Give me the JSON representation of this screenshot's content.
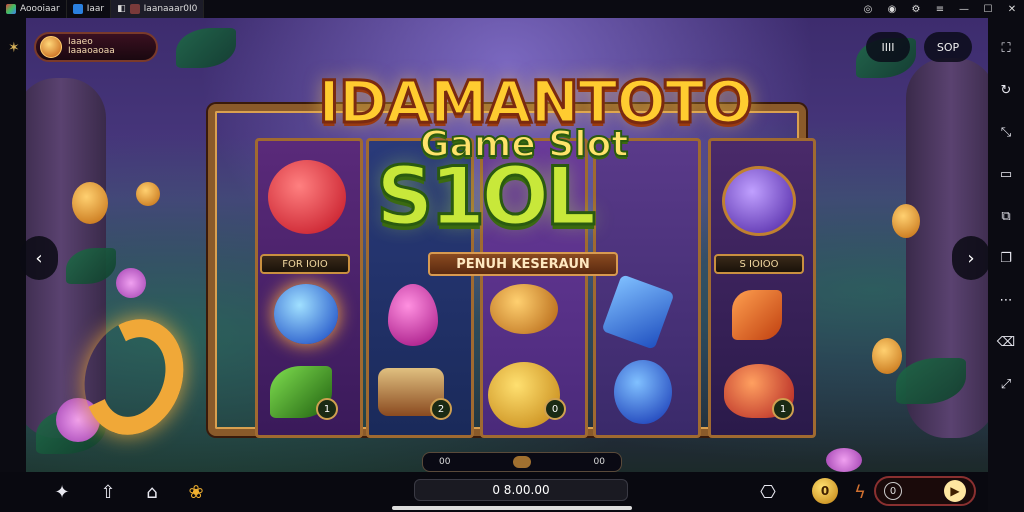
{
  "window": {
    "tabs": [
      {
        "label": "Aoooiaar",
        "icon": "app-store-icon"
      },
      {
        "label": "Iaar",
        "icon": "browser-icon"
      },
      {
        "label": "Iaanaaar0I0",
        "icon": "game-tab-icon"
      }
    ],
    "controls": [
      "circle-icon",
      "target-icon",
      "settings-icon",
      "menu-icon",
      "minimize-icon",
      "maximize-icon",
      "close-icon"
    ]
  },
  "game": {
    "badge": {
      "line1": "Iaaeo",
      "line2": "Iaaaoaoaa"
    },
    "top_right_pills": [
      "IIII",
      "SOP"
    ],
    "title": "IDAMANTOTO",
    "subtitle_small": "Game Slot",
    "subtitle_big": "S1OL",
    "banner": "PENUH KESERAUN",
    "reel_labels": [
      "FOR IOIO",
      "S IOIOO"
    ],
    "reel_counts": [
      "1",
      "2",
      "0",
      "1"
    ],
    "counter": {
      "left": "00",
      "right": "00"
    }
  },
  "bottom": {
    "balance": "0 8.00.00",
    "coin_label": "0",
    "spin_left": "0",
    "spin_right": "▶"
  },
  "colors": {
    "accent": "#ffcc30",
    "frame": "#8a5a2a",
    "bg": "#3d2c6e"
  }
}
